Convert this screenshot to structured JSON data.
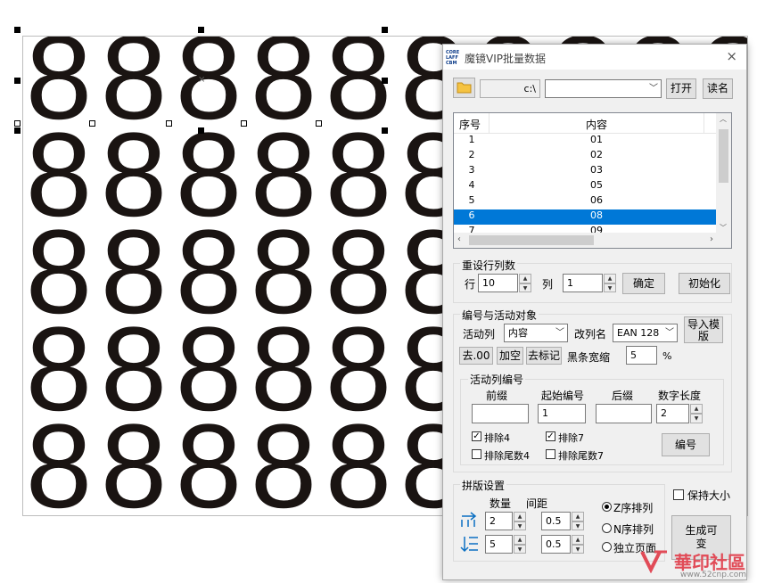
{
  "canvas": {
    "digit": "8"
  },
  "dialog": {
    "logo_text": "CORE LAFF CBM",
    "title": "魔镜VIP批量数据",
    "close_glyph": "×",
    "path_value": "c:\\",
    "open_label": "打开",
    "read_label": "读名",
    "table": {
      "col_index": "序号",
      "col_content": "内容",
      "rows": [
        {
          "idx": "1",
          "val": "01"
        },
        {
          "idx": "2",
          "val": "02"
        },
        {
          "idx": "3",
          "val": "03"
        },
        {
          "idx": "4",
          "val": "05"
        },
        {
          "idx": "5",
          "val": "06"
        },
        {
          "idx": "6",
          "val": "08"
        },
        {
          "idx": "7",
          "val": "09"
        }
      ],
      "selected_row": 6
    },
    "reset": {
      "title": "重设行列数",
      "row_label": "行",
      "row_value": "10",
      "col_label": "列",
      "col_value": "1",
      "confirm_label": "确定",
      "init_label": "初始化"
    },
    "numbering": {
      "title": "编号与活动对象",
      "active_col_label": "活动列",
      "active_col_value": "内容",
      "rename_label": "改列名",
      "rename_value": "EAN 128",
      "import_label": "导入模版",
      "strip00_label": "去.00",
      "addspace_label": "加空",
      "strip_mark_label": "去标记",
      "bar_shrink_label": "黑条宽缩",
      "bar_shrink_value": "5",
      "percent": "%",
      "sub": {
        "title": "活动列编号",
        "prefix_label": "前缀",
        "start_label": "起始编号",
        "suffix_label": "后缀",
        "digits_label": "数字长度",
        "prefix_value": "",
        "start_value": "1",
        "suffix_value": "",
        "digits_value": "2",
        "ex4_label": "排除4",
        "ex4_checked": true,
        "ex7_label": "排除7",
        "ex7_checked": true,
        "ext4_label": "排除尾数4",
        "ext4_checked": false,
        "ext7_label": "排除尾数7",
        "ext7_checked": false,
        "number_label": "编号"
      }
    },
    "layout": {
      "title": "拼版设置",
      "qty_label": "数量",
      "gap_label": "间距",
      "h_qty": "2",
      "h_gap": "0.5",
      "v_qty": "5",
      "v_gap": "0.5",
      "z_order_label": "Z序排列",
      "n_order_label": "N序排列",
      "single_page_label": "独立页面",
      "selected_order": "Z序排列",
      "keep_size_label": "保持大小",
      "keep_size_checked": false,
      "generate_label": "生成可变"
    }
  },
  "watermark": {
    "text": "華印社區",
    "url": "www.52cnp.com"
  }
}
